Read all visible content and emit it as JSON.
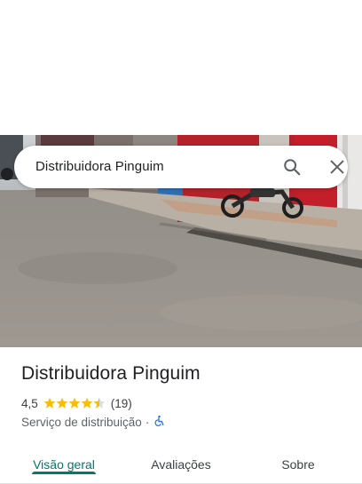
{
  "search": {
    "query": "Distribuidora Pinguim",
    "search_icon": "search-icon",
    "close_icon": "close-icon"
  },
  "place": {
    "title": "Distribuidora Pinguim",
    "rating": "4,5",
    "rating_stars": 4.5,
    "review_count": "(19)",
    "category": "Serviço de distribuição",
    "separator": "·",
    "accessibility_icon": "wheelchair-icon"
  },
  "tabs": [
    {
      "label": "Visão geral",
      "active": true
    },
    {
      "label": "Avaliações",
      "active": false
    },
    {
      "label": "Sobre",
      "active": false
    }
  ],
  "colors": {
    "accent": "#01796f",
    "star": "#fbbc04",
    "accessibility": "#1a73e8"
  }
}
